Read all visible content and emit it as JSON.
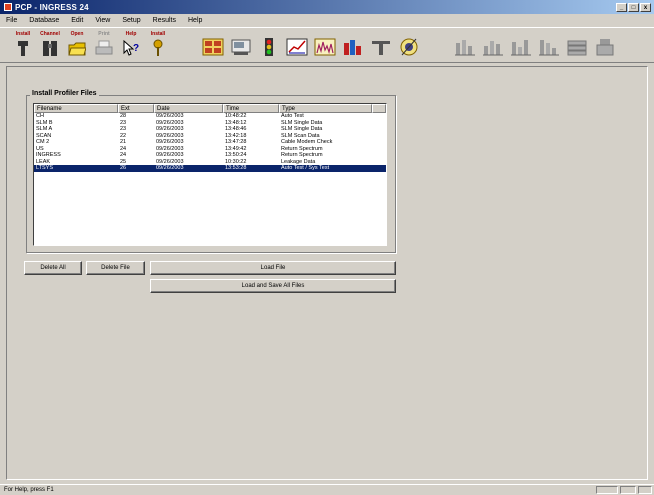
{
  "window": {
    "title": "PCP - INGRESS 24",
    "min": "_",
    "max": "□",
    "close": "x"
  },
  "menu": [
    "File",
    "Database",
    "Edit",
    "View",
    "Setup",
    "Results",
    "Help"
  ],
  "toolbar": {
    "buttons": [
      {
        "label": "Install",
        "icon": "install-icon"
      },
      {
        "label": "Channel",
        "icon": "channel-icon"
      },
      {
        "label": "Open",
        "icon": "open-folder-icon"
      },
      {
        "label": "Print",
        "icon": "print-icon"
      },
      {
        "label": "Help",
        "icon": "help-icon"
      },
      {
        "label": "Install",
        "icon": "install-wrench-icon"
      }
    ]
  },
  "panel": {
    "title": "Install Profiler Files",
    "columns": [
      "Filename",
      "Ext",
      "Date",
      "Time",
      "Type"
    ],
    "rows": [
      [
        "CH",
        "28",
        "09/26/2003",
        "10:48:22",
        "Auto Test"
      ],
      [
        "SLM B",
        "23",
        "09/26/2003",
        "13:48:12",
        "SLM Single Data"
      ],
      [
        "SLM A",
        "23",
        "09/26/2003",
        "13:48:46",
        "SLM Single Data"
      ],
      [
        "SCAN",
        "22",
        "09/26/2003",
        "13:42:18",
        "SLM Scan Data"
      ],
      [
        "CM 2",
        "21",
        "09/26/2003",
        "13:47:28",
        "Cable Modem Check"
      ],
      [
        "US",
        "24",
        "09/26/2003",
        "13:49:42",
        "Return Spectrum"
      ],
      [
        "INGRESS",
        "24",
        "09/26/2003",
        "13:50:24",
        "Return Spectrum"
      ],
      [
        "LEAK",
        "25",
        "09/26/2003",
        "10:30:22",
        "Leakage Data"
      ],
      [
        "LTSYS",
        "26",
        "09/26/2003",
        "13:53:28",
        "Auto Test / Sys Test"
      ]
    ],
    "selected_row": 8
  },
  "buttons": {
    "delete_all": "Delete All",
    "delete_file": "Delete File",
    "load_file": "Load File",
    "load_save_all": "Load and Save All Files"
  },
  "status": {
    "text": "For Help, press F1"
  }
}
